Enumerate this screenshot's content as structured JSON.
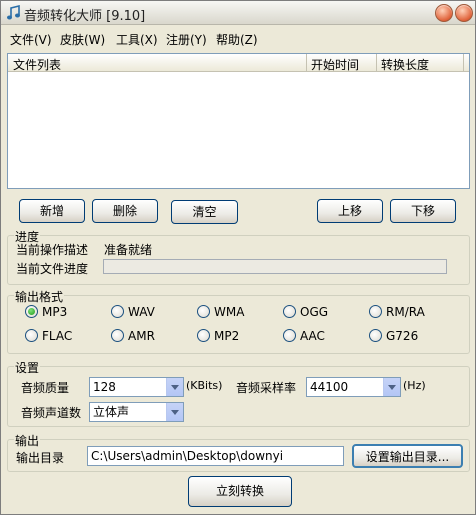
{
  "window": {
    "title": "音频转化大师 [9.10]"
  },
  "menu": [
    "文件(V)",
    "皮肤(W)",
    "工具(X)",
    "注册(Y)",
    "帮助(Z)"
  ],
  "file_list": {
    "columns": [
      "文件列表",
      "开始时间",
      "转换长度"
    ]
  },
  "buttons": {
    "add": "新增",
    "delete": "删除",
    "clear": "清空",
    "move_up": "上移",
    "move_down": "下移",
    "set_output_dir": "设置输出目录...",
    "convert": "立刻转换"
  },
  "progress": {
    "group_label": "进度",
    "current_op_label": "当前操作描述",
    "current_op_value": "准备就绪",
    "file_progress_label": "当前文件进度",
    "file_progress_value": 0
  },
  "format": {
    "group_label": "输出格式",
    "options": [
      "MP3",
      "WAV",
      "WMA",
      "OGG",
      "RM/RA",
      "FLAC",
      "AMR",
      "MP2",
      "AAC",
      "G726"
    ],
    "selected": "MP3"
  },
  "settings": {
    "group_label": "设置",
    "quality_label": "音频质量",
    "quality_value": "128",
    "quality_unit": "(KBits)",
    "sample_rate_label": "音频采样率",
    "sample_rate_value": "44100",
    "sample_rate_unit": "(Hz)",
    "channels_label": "音频声道数",
    "channels_value": "立体声"
  },
  "output": {
    "group_label": "输出",
    "dir_label": "输出目录",
    "dir_value": "C:\\Users\\admin\\Desktop\\downyi"
  }
}
